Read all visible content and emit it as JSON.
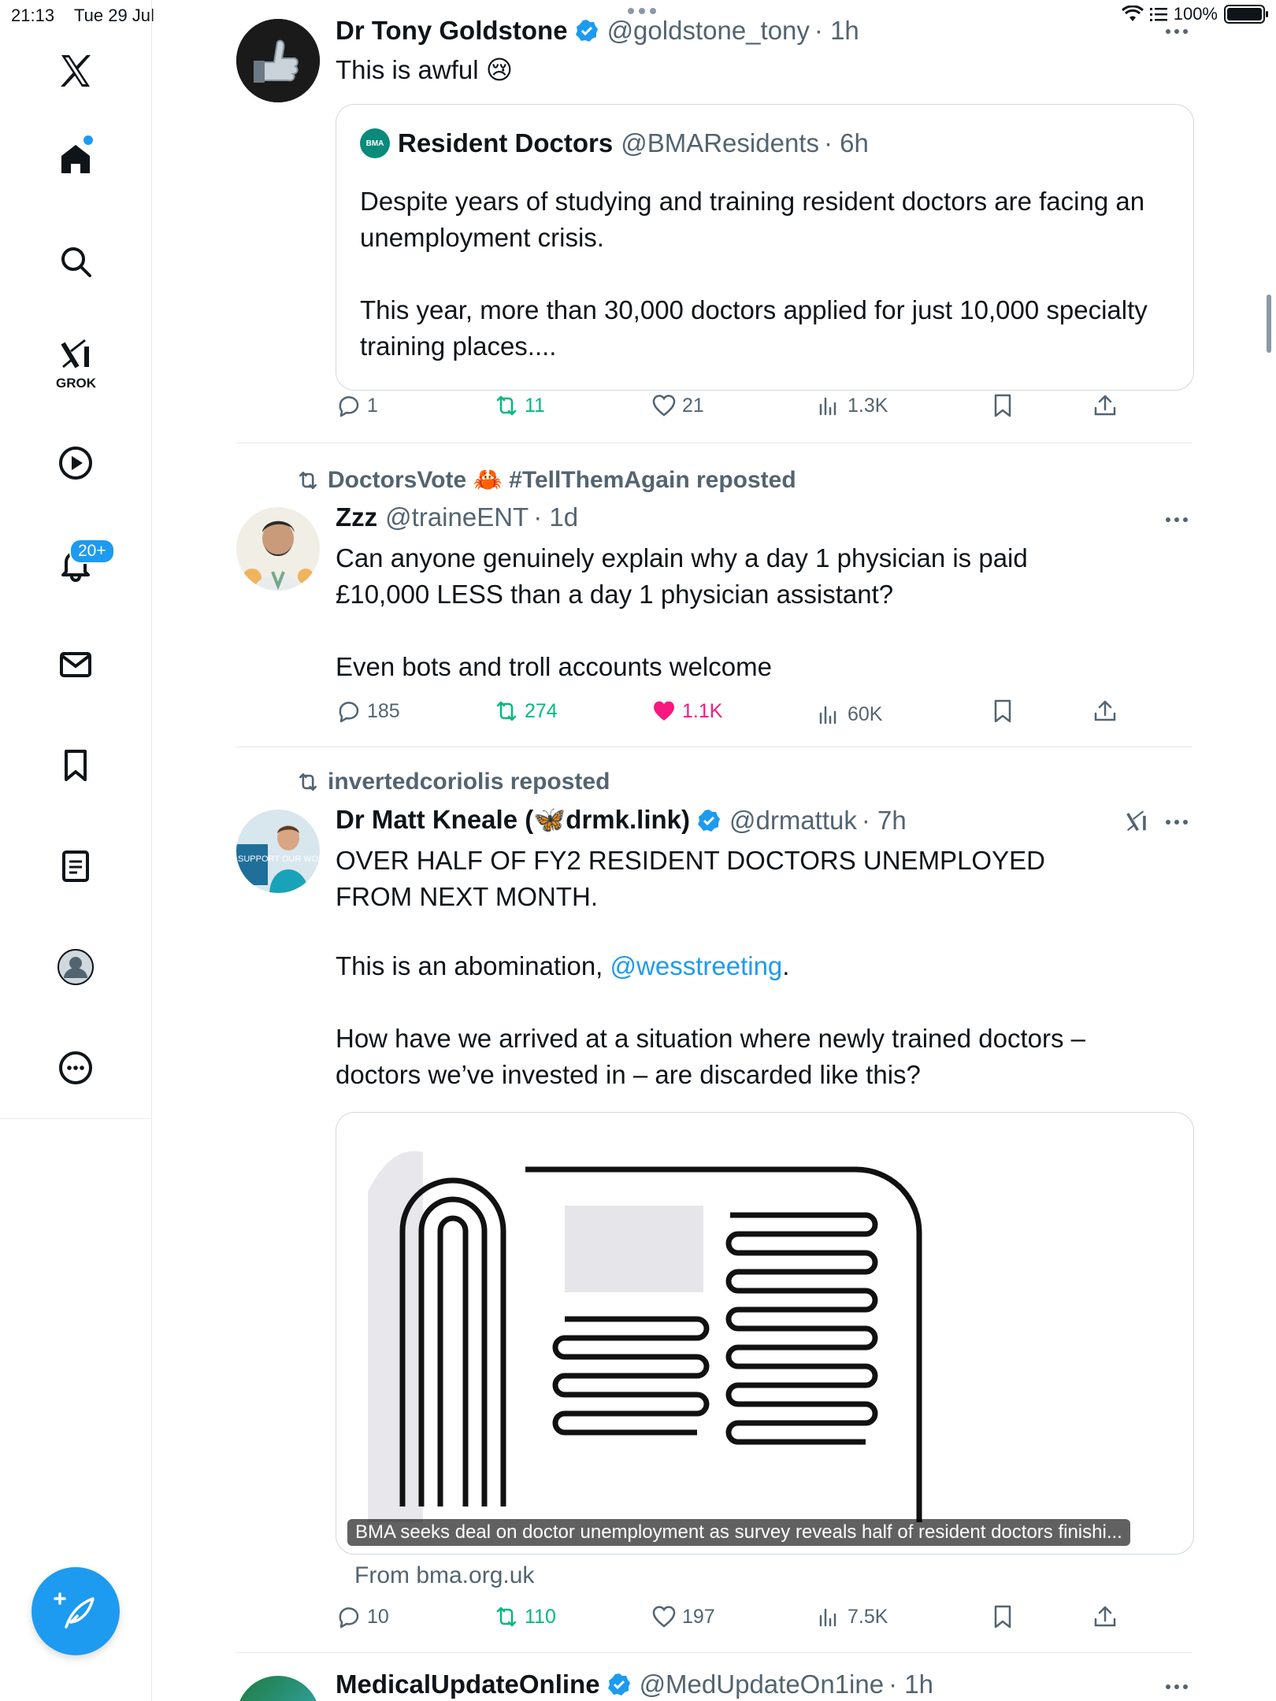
{
  "status_bar": {
    "time": "21:13",
    "date": "Tue 29 Jul",
    "battery": "100%"
  },
  "sidebar": {
    "grok_label": "GROK",
    "notifications_badge": "20+"
  },
  "tweets": [
    {
      "name": "Dr Tony Goldstone",
      "handle": "@goldstone_tony",
      "time": "· 1h",
      "text": "This is awful 😢",
      "quote": {
        "name": "Resident Doctors",
        "logo_text": "BMA",
        "handle": "@BMAResidents",
        "time": "· 6h",
        "text": "Despite years of studying and training resident doctors are facing an unemployment crisis.\n\nThis year, more than 30,000 doctors applied for just 10,000 specialty training places...."
      },
      "stats": {
        "replies": "1",
        "reposts": "11",
        "likes": "21",
        "views": "1.3K"
      }
    },
    {
      "repost_by": "DoctorsVote 🦀 #TellThemAgain reposted",
      "name": "Zzz",
      "handle": "@traineENT",
      "time": "· 1d",
      "text": "Can anyone genuinely explain why a day 1 physician is paid £10,000 LESS than a day 1 physician assistant?\n\nEven bots and troll accounts welcome",
      "stats": {
        "replies": "185",
        "reposts": "274",
        "likes": "1.1K",
        "views": "60K"
      }
    },
    {
      "repost_by": "invertedcoriolis reposted",
      "name": "Dr Matt Kneale (🦋drmk.link)",
      "handle": "@drmattuk",
      "time": "· 7h",
      "text_1": "OVER HALF OF FY2 RESIDENT DOCTORS UNEMPLOYED FROM NEXT MONTH.",
      "text_2": "This is an abomination, ",
      "mention": "@wesstreeting",
      "text_2_end": ".",
      "text_3": "How have we arrived at a situation where newly trained doctors – doctors we’ve invested in – are discarded like this?",
      "avatar_sign": "SUPPORT OUR WORK",
      "card": {
        "caption": "BMA seeks deal on doctor unemployment as survey reveals half of resident doctors finishi...",
        "source": "From bma.org.uk"
      },
      "stats": {
        "replies": "10",
        "reposts": "110",
        "likes": "197",
        "views": "7.5K"
      }
    },
    {
      "name": "MedicalUpdateOnline",
      "handle": "@MedUpdateOn1ine",
      "time": "· 1h"
    }
  ],
  "colors": {
    "accent": "#1d9bf0",
    "repost_green": "#00ba7c",
    "like_pink": "#f91880",
    "muted": "#536471"
  }
}
